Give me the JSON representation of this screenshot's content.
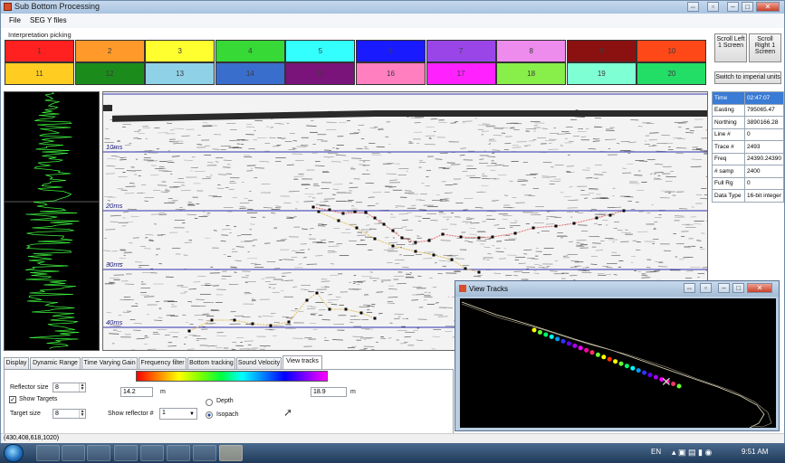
{
  "window": {
    "title": "Sub Bottom Processing",
    "menu": [
      "File",
      "SEG Y files"
    ]
  },
  "interpretation": {
    "label": "Interpretation picking",
    "row1": [
      {
        "label": "1",
        "color": "#ff2020"
      },
      {
        "label": "2",
        "color": "#ff9a2a"
      },
      {
        "label": "3",
        "color": "#ffff30"
      },
      {
        "label": "4",
        "color": "#36d936"
      },
      {
        "label": "5",
        "color": "#33ffff"
      },
      {
        "label": "6",
        "color": "#1a1aff"
      },
      {
        "label": "7",
        "color": "#9a45e8"
      },
      {
        "label": "8",
        "color": "#ee8cee"
      },
      {
        "label": "9",
        "color": "#8b1010"
      },
      {
        "label": "10",
        "color": "#ff4818"
      }
    ],
    "row2": [
      {
        "label": "11",
        "color": "#ffcc22"
      },
      {
        "label": "12",
        "color": "#1b8c1b"
      },
      {
        "label": "13",
        "color": "#8fd2e8"
      },
      {
        "label": "14",
        "color": "#3a6ecc"
      },
      {
        "label": "15",
        "color": "#7a137a"
      },
      {
        "label": "16",
        "color": "#ff7fbf"
      },
      {
        "label": "17",
        "color": "#ff22ff"
      },
      {
        "label": "18",
        "color": "#88ee4a"
      },
      {
        "label": "19",
        "color": "#7fffd4"
      },
      {
        "label": "20",
        "color": "#22dd66"
      }
    ]
  },
  "side_buttons": {
    "scroll_left": "Scroll Left 1 Screen",
    "scroll_right": "Scroll Right 1 Screen",
    "switch_units": "Switch to imperial units"
  },
  "seismic": {
    "depth_labels": [
      "10ms",
      "20ms",
      "30ms",
      "40ms"
    ]
  },
  "info": [
    {
      "key": "Time",
      "value": "02:47:07"
    },
    {
      "key": "Easting",
      "value": "795065.47"
    },
    {
      "key": "Northing",
      "value": "3890166.28"
    },
    {
      "key": "Line #",
      "value": "0"
    },
    {
      "key": "Trace #",
      "value": "2493"
    },
    {
      "key": "Freq",
      "value": "24390.24390"
    },
    {
      "key": "# samp",
      "value": "2400"
    },
    {
      "key": "Full Rg",
      "value": "0"
    },
    {
      "key": "Data Type",
      "value": "16-bit integer"
    }
  ],
  "tabs": [
    "Display",
    "Dynamic Range",
    "Time Varying Gain",
    "Frequency filter",
    "Bottom tracking",
    "Sound Velocity",
    "View tracks"
  ],
  "active_tab": "View tracks",
  "panel": {
    "reflector_size_label": "Reflector size",
    "reflector_size": "8",
    "show_targets_label": "Show Targets",
    "show_targets": true,
    "target_size_label": "Target size",
    "target_size": "8",
    "show_reflector_label": "Show reflector #",
    "show_reflector": "1",
    "range_min": "14.2",
    "range_max": "18.9",
    "unit_min": "m",
    "unit_max": "m",
    "depth_label": "Depth",
    "isopach_label": "Isopach",
    "selected_mode": "Isopach"
  },
  "view_tracks": {
    "title": "View Tracks"
  },
  "status": {
    "text": "(430,408,618,1020)"
  },
  "taskbar": {
    "language": "EN",
    "time": "9:51 AM"
  }
}
